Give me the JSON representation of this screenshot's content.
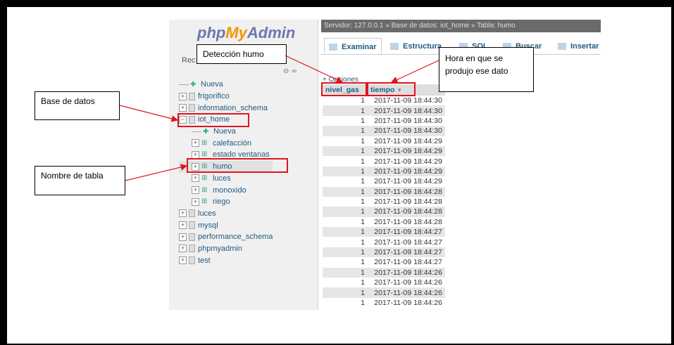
{
  "app": {
    "logo_php": "php",
    "logo_my": "My",
    "logo_admin": "Admin",
    "reci": "Rec"
  },
  "breadcrumb": "Servidor: 127.0.0.1 » Base de datos: iot_home » Tabla: humo",
  "tabs": [
    "Examinar",
    "Estructura",
    "SQL",
    "Buscar",
    "Insertar"
  ],
  "opciones": "+ Opciones",
  "tree": {
    "top": [
      "Nueva",
      "frigorifico",
      "information_schema"
    ],
    "selected_db": "iot_home",
    "children": [
      "Nueva",
      "calefacción",
      "estado ventanas",
      "humo",
      "luces",
      "monoxido",
      "riego"
    ],
    "bottom": [
      "luces",
      "mysql",
      "performance_schema",
      "phpmyadmin",
      "test"
    ]
  },
  "table": {
    "headers": [
      "nivel_gas",
      "tiempo"
    ],
    "sort_indicator": "▼",
    "rows": [
      [
        "1",
        "2017-11-09 18:44:30"
      ],
      [
        "1",
        "2017-11-09 18:44:30"
      ],
      [
        "1",
        "2017-11-09 18:44:30"
      ],
      [
        "1",
        "2017-11-09 18:44:30"
      ],
      [
        "1",
        "2017-11-09 18:44:29"
      ],
      [
        "1",
        "2017-11-09 18:44:29"
      ],
      [
        "1",
        "2017-11-09 18:44:29"
      ],
      [
        "1",
        "2017-11-09 18:44:29"
      ],
      [
        "1",
        "2017-11-09 18:44:29"
      ],
      [
        "1",
        "2017-11-09 18:44:28"
      ],
      [
        "1",
        "2017-11-09 18:44:28"
      ],
      [
        "1",
        "2017-11-09 18:44:28"
      ],
      [
        "1",
        "2017-11-09 18:44:28"
      ],
      [
        "1",
        "2017-11-09 18:44:27"
      ],
      [
        "1",
        "2017-11-09 18:44:27"
      ],
      [
        "1",
        "2017-11-09 18:44:27"
      ],
      [
        "1",
        "2017-11-09 18:44:27"
      ],
      [
        "1",
        "2017-11-09 18:44:26"
      ],
      [
        "1",
        "2017-11-09 18:44:26"
      ],
      [
        "1",
        "2017-11-09 18:44:26"
      ],
      [
        "1",
        "2017-11-09 18:44:26"
      ]
    ]
  },
  "callouts": {
    "deteccion": "Detección humo",
    "base_datos": "Base de datos",
    "nombre_tabla": "Nombre de tabla",
    "hora": "Hora en que se produjo ese dato"
  },
  "colors": {
    "highlight": "#e0141e",
    "link": "#235a81"
  }
}
